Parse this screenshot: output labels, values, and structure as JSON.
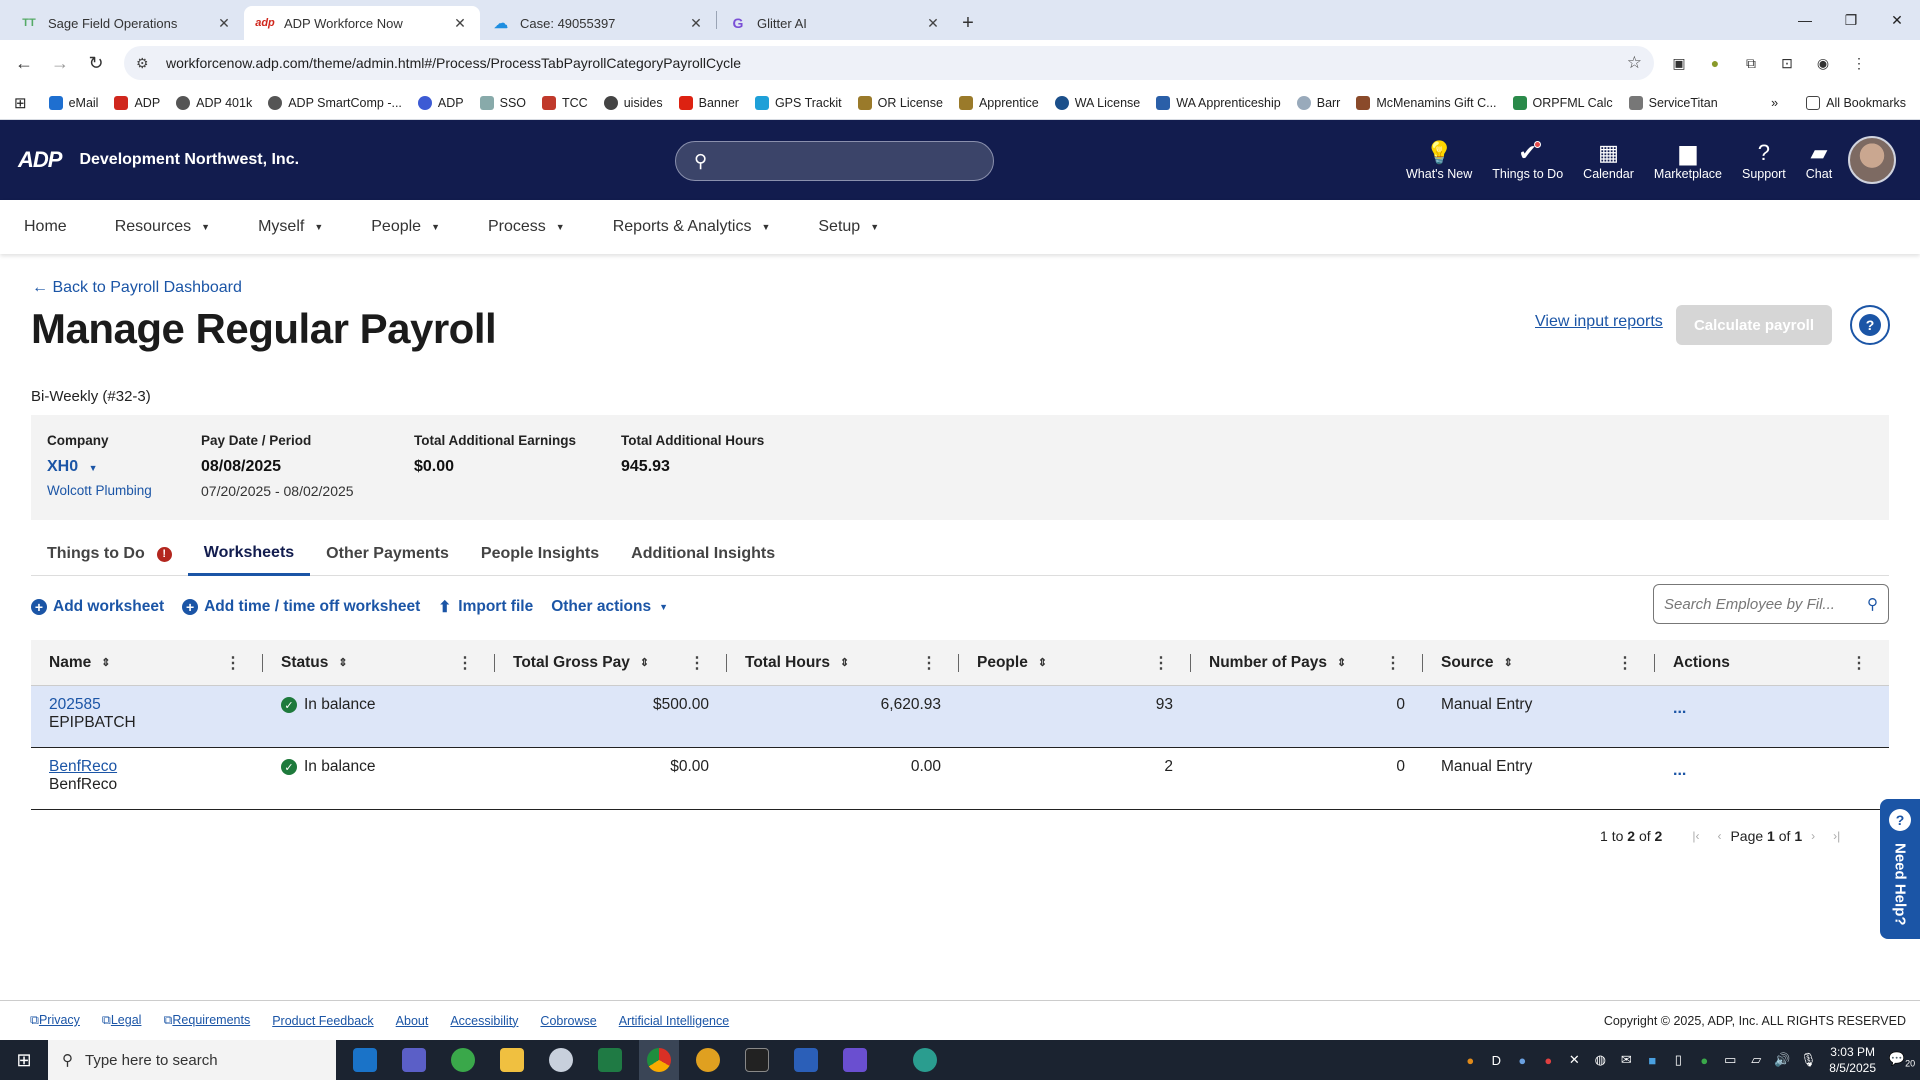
{
  "browser": {
    "tabs": [
      {
        "label": "Sage Field Operations",
        "favicon": "TT",
        "active": false
      },
      {
        "label": "ADP Workforce Now",
        "favicon": "adp",
        "active": true
      },
      {
        "label": "Case: 49055397",
        "favicon": "cloud",
        "active": false
      },
      {
        "label": "Glitter AI",
        "favicon": "G",
        "active": false
      }
    ],
    "url": "workforcenow.adp.com/theme/admin.html#/Process/ProcessTabPayrollCategoryPayrollCycle",
    "bookmarks": [
      "eMail",
      "ADP",
      "ADP 401k",
      "ADP SmartComp -...",
      "ADP",
      "SSO",
      "TCC",
      "uisides",
      "Banner",
      "GPS Trackit",
      "OR License",
      "Apprentice",
      "WA License",
      "WA Apprenticeship",
      "Barr",
      "McMenamins Gift C...",
      "ORPFML Calc",
      "ServiceTitan"
    ],
    "all_bookmarks": "All Bookmarks"
  },
  "header": {
    "logo": "ADP",
    "company": "Development Northwest, Inc.",
    "icons": [
      {
        "label": "What's New",
        "icon": "lightbulb-icon"
      },
      {
        "label": "Things to Do",
        "icon": "check-icon"
      },
      {
        "label": "Calendar",
        "icon": "calendar-icon"
      },
      {
        "label": "Marketplace",
        "icon": "bag-icon"
      },
      {
        "label": "Support",
        "icon": "question-icon"
      },
      {
        "label": "Chat",
        "icon": "chat-icon"
      }
    ]
  },
  "nav": [
    "Home",
    "Resources",
    "Myself",
    "People",
    "Process",
    "Reports & Analytics",
    "Setup"
  ],
  "page": {
    "back": "Back to Payroll Dashboard",
    "title": "Manage Regular Payroll",
    "view_reports": "View input reports",
    "calculate": "Calculate payroll",
    "cycle": "Bi-Weekly (#32-3)"
  },
  "summary": {
    "company_label": "Company",
    "company_code": "XH0",
    "company_name": "Wolcott Plumbing",
    "pay_label": "Pay Date / Period",
    "pay_date": "08/08/2025",
    "period": "07/20/2025 - 08/02/2025",
    "earnings_label": "Total Additional Earnings",
    "earnings": "$0.00",
    "hours_label": "Total Additional Hours",
    "hours": "945.93"
  },
  "tabs": [
    "Things to Do",
    "Worksheets",
    "Other Payments",
    "People Insights",
    "Additional Insights"
  ],
  "actions": {
    "add_worksheet": "Add worksheet",
    "add_time": "Add time / time off worksheet",
    "import": "Import file",
    "other": "Other actions",
    "search_placeholder": "Search Employee by Fil..."
  },
  "table": {
    "columns": [
      "Name",
      "Status",
      "Total Gross Pay",
      "Total Hours",
      "People",
      "Number of Pays",
      "Source",
      "Actions"
    ],
    "rows": [
      {
        "id": "202585",
        "name": "EPIPBATCH",
        "status": "In balance",
        "gross": "$500.00",
        "hours": "6,620.93",
        "people": "93",
        "pays": "0",
        "source": "Manual Entry",
        "actions": "..."
      },
      {
        "id": "BenfReco",
        "name": "BenfReco",
        "status": "In balance",
        "gross": "$0.00",
        "hours": "0.00",
        "people": "2",
        "pays": "0",
        "source": "Manual Entry",
        "actions": "..."
      }
    ]
  },
  "pager": {
    "range_a": "1",
    "range_to": "to",
    "range_b": "2",
    "range_of": "of",
    "total": "2",
    "page": "Page",
    "page_cur": "1",
    "page_of": "of",
    "page_total": "1"
  },
  "need_help": "Need Help?",
  "footer": {
    "links": [
      "Privacy",
      "Legal",
      "Requirements",
      "Product Feedback",
      "About",
      "Accessibility",
      "Cobrowse",
      "Artificial Intelligence"
    ],
    "copyright": "Copyright © 2025, ADP, Inc. ALL RIGHTS RESERVED"
  },
  "taskbar": {
    "search": "Type here to search",
    "time": "3:03 PM",
    "date": "8/5/2025",
    "notif": "20"
  },
  "colors": {
    "adp_navy": "#121c4e",
    "link_blue": "#1b55a6",
    "ok_green": "#1e7a3c",
    "selected_row": "#dde6f8"
  }
}
